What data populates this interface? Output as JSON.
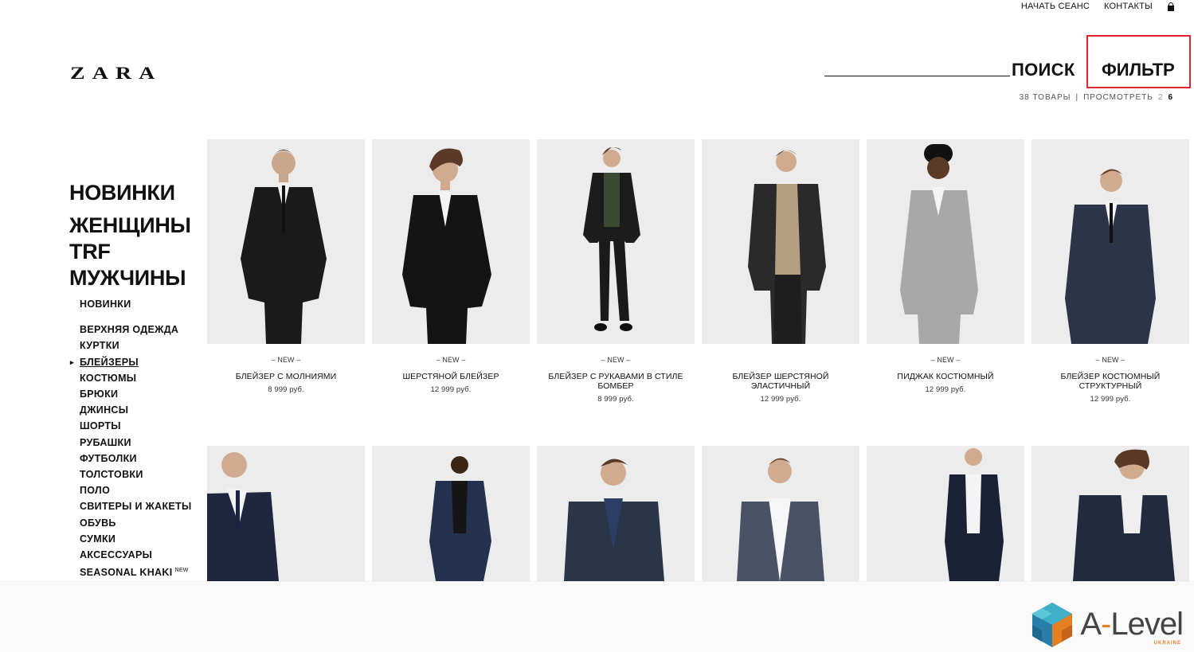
{
  "topbar": {
    "login": "НАЧАТЬ СЕАНС",
    "contacts": "КОНТАКТЫ"
  },
  "logo": "ZARA",
  "search": {
    "label": "ПОИСК"
  },
  "filter": {
    "label": "ФИЛЬТР"
  },
  "items_bar": {
    "count": "38 ТОВАРЫ",
    "view_label": "ПРОСМОТРЕТЬ",
    "view_options": [
      "2",
      "6"
    ]
  },
  "nav": {
    "main": [
      "НОВИНКИ",
      "ЖЕНЩИНЫ",
      "TRF",
      "МУЖЧИНЫ"
    ],
    "sub": [
      "НОВИНКИ",
      "ВЕРХНЯЯ ОДЕЖДА",
      "КУРТКИ",
      "БЛЕЙЗЕРЫ",
      "КОСТЮМЫ",
      "БРЮКИ",
      "ДЖИНСЫ",
      "ШОРТЫ",
      "РУБАШКИ",
      "ФУТБОЛКИ",
      "ТОЛСТОВКИ",
      "ПОЛО",
      "СВИТЕРЫ И ЖАКЕТЫ",
      "ОБУВЬ",
      "СУМКИ",
      "АКСЕССУАРЫ",
      "SEASONAL KHAKI"
    ],
    "new_tag": "NEW"
  },
  "products": [
    {
      "badge": "– NEW –",
      "name": "БЛЕЙЗЕР С МОЛНИЯМИ",
      "price": "8 999 руб."
    },
    {
      "badge": "– NEW –",
      "name": "ШЕРСТЯНОЙ БЛЕЙЗЕР",
      "price": "12 999 руб."
    },
    {
      "badge": "– NEW –",
      "name": "БЛЕЙЗЕР С РУКАВАМИ В СТИЛЕ БОМБЕР",
      "price": "8 999 руб."
    },
    {
      "badge": "",
      "name": "БЛЕЙЗЕР ШЕРСТЯНОЙ ЭЛАСТИЧНЫЙ",
      "price": "12 999 руб."
    },
    {
      "badge": "– NEW –",
      "name": "ПИДЖАК КОСТЮМНЫЙ",
      "price": "12 999 руб."
    },
    {
      "badge": "– NEW –",
      "name": "БЛЕЙЗЕР КОСТЮМНЫЙ СТРУКТУРНЫЙ",
      "price": "12 999 руб."
    }
  ],
  "watermark": {
    "brand_a": "A",
    "brand_dash": "-",
    "brand_rest": "Level",
    "sub": "UKRAINE"
  },
  "colors": {
    "filter_highlight": "#e0242c",
    "accent": "#e67e22"
  }
}
